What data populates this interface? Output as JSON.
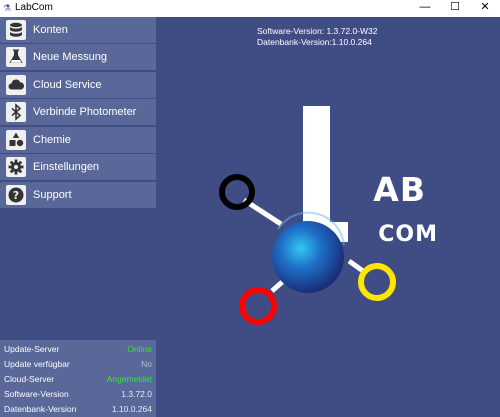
{
  "window": {
    "title": "LabCom",
    "app_icon": "lab-logo-icon",
    "minimize": "—",
    "maximize": "☐",
    "close": "✕"
  },
  "sidebar": {
    "items": [
      {
        "label": "Konten",
        "icon": "database-icon"
      },
      {
        "label": "Neue Messung",
        "icon": "flask-icon"
      },
      {
        "label": "Cloud Service",
        "icon": "cloud-icon"
      },
      {
        "label": "Verbinde Photometer",
        "icon": "bluetooth-icon"
      },
      {
        "label": "Chemie",
        "icon": "shapes-icon"
      },
      {
        "label": "Einstellungen",
        "icon": "gear-icon"
      },
      {
        "label": "Support",
        "icon": "question-icon"
      }
    ]
  },
  "status": {
    "rows": [
      {
        "key": "Update-Server",
        "value": "Online"
      },
      {
        "key": "Update verfügbar",
        "value": "No"
      },
      {
        "key": "Cloud-Server",
        "value": "Angemeldet"
      },
      {
        "key": "Software-Version",
        "value": "1.3.72.0"
      },
      {
        "key": "Datenbank-Version",
        "value": "1.10.0.264"
      }
    ],
    "colors": {
      "ok": "#2eea2e"
    }
  },
  "main": {
    "software_version": "Software-Version: 1.3.72.0-W32",
    "database_version": "Datenbank-Version:1.10.0.264",
    "logo": {
      "lab": "AB",
      "com": "COM",
      "colors": {
        "black": "#000000",
        "red": "#ff0000",
        "yellow": "#ffe600",
        "sphere": "#1e6fc8"
      }
    }
  }
}
